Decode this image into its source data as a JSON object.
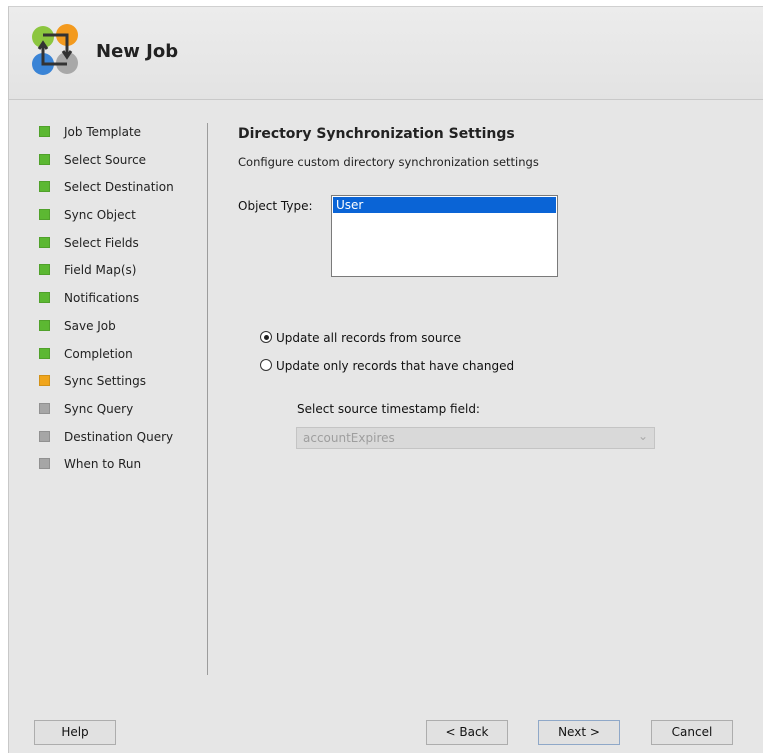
{
  "header": {
    "title": "New Job",
    "logo_icon": "workflow-logo-icon"
  },
  "steps": [
    {
      "label": "Job Template",
      "status": "complete",
      "color": "#5cb832"
    },
    {
      "label": "Select Source",
      "status": "complete",
      "color": "#5cb832"
    },
    {
      "label": "Select Destination",
      "status": "complete",
      "color": "#5cb832"
    },
    {
      "label": "Sync Object",
      "status": "complete",
      "color": "#5cb832"
    },
    {
      "label": "Select Fields",
      "status": "complete",
      "color": "#5cb832"
    },
    {
      "label": "Field Map(s)",
      "status": "complete",
      "color": "#5cb832"
    },
    {
      "label": "Notifications",
      "status": "complete",
      "color": "#5cb832"
    },
    {
      "label": "Save Job",
      "status": "complete",
      "color": "#5cb832"
    },
    {
      "label": "Completion",
      "status": "complete",
      "color": "#5cb832"
    },
    {
      "label": "Sync Settings",
      "status": "current",
      "color": "#f0a51c"
    },
    {
      "label": "Sync Query",
      "status": "pending",
      "color": "#a6a6a6"
    },
    {
      "label": "Destination Query",
      "status": "pending",
      "color": "#a6a6a6"
    },
    {
      "label": "When to Run",
      "status": "pending",
      "color": "#a6a6a6"
    }
  ],
  "main": {
    "title": "Directory Synchronization Settings",
    "description": "Configure custom directory synchronization settings",
    "object_type_label": "Object Type:",
    "object_types": [
      "User"
    ],
    "selected_object_type": "User",
    "radio_all": "Update all records from source",
    "radio_changed": "Update only records that have changed",
    "selected_radio": "all",
    "timestamp_label": "Select source timestamp field:",
    "timestamp_value": "accountExpires",
    "timestamp_enabled": false
  },
  "buttons": {
    "help": "Help",
    "back": "< Back",
    "next": "Next >",
    "cancel": "Cancel"
  }
}
